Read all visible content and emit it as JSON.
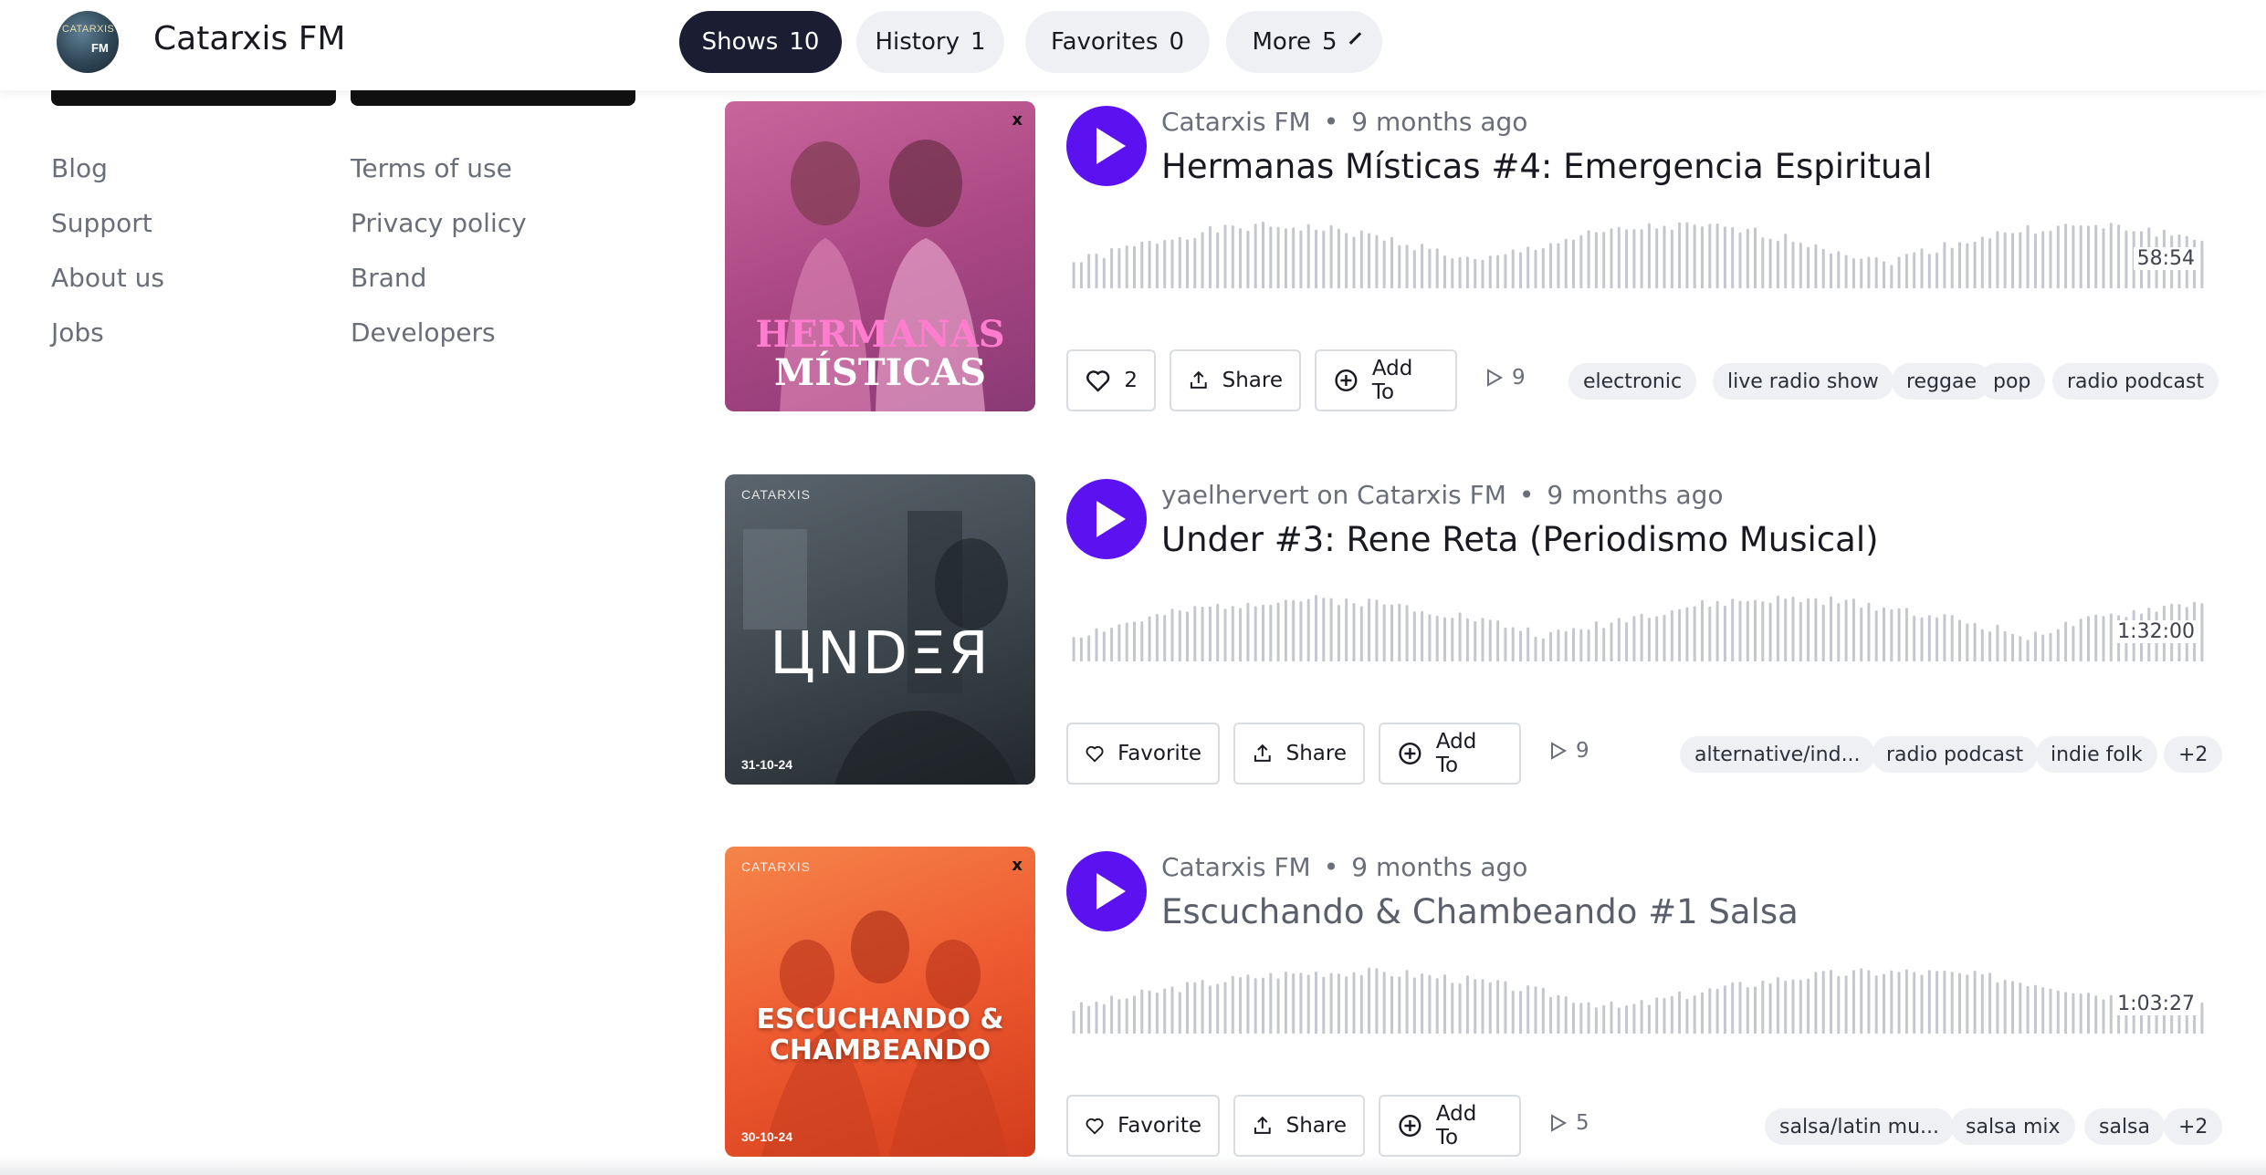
{
  "header": {
    "brand_name": "Catarxis FM",
    "avatar_text_top": "CATARXIS",
    "avatar_text_bottom": "FM",
    "tabs": [
      {
        "label": "Shows",
        "count": "10",
        "active": true
      },
      {
        "label": "History",
        "count": "1",
        "active": false
      },
      {
        "label": "Favorites",
        "count": "0",
        "active": false
      },
      {
        "label": "More",
        "count": "5",
        "active": false
      }
    ]
  },
  "sidebar": {
    "links_col1": [
      "Blog",
      "Support",
      "About us",
      "Jobs"
    ],
    "links_col2": [
      "Terms of use",
      "Privacy policy",
      "Brand",
      "Developers"
    ]
  },
  "shows": [
    {
      "author": "Catarxis FM",
      "time": "9 months ago",
      "title": "Hermanas Místicas #4: Emergencia Espiritual",
      "duration": "58:54",
      "favorite_count": "2",
      "share_label": "Share",
      "add_label": "Add To",
      "plays": "9",
      "tags": [
        "electronic",
        "live radio show",
        "reggae",
        "pop",
        "radio podcast"
      ],
      "art_title_line1": "HERMANAS",
      "art_title_line2": "MÍSTICAS",
      "art_colors": [
        "#b8528c",
        "#8a3a76"
      ]
    },
    {
      "author": "yaelhervert on Catarxis FM",
      "time": "9 months ago",
      "title": "Under #3: Rene Reta (Periodismo Musical)",
      "duration": "1:32:00",
      "favorite_label": "Favorite",
      "share_label": "Share",
      "add_label": "Add To",
      "plays": "9",
      "tags": [
        "alternative/ind...",
        "radio podcast",
        "indie folk",
        "+2"
      ],
      "art_small": "CATARXIS",
      "art_title_line1": "ЦNDΞЯ",
      "art_date": "31-10-24",
      "art_colors": [
        "#4a535b",
        "#262c31"
      ]
    },
    {
      "author": "Catarxis FM",
      "time": "9 months ago",
      "title": "Escuchando & Chambeando #1 Salsa",
      "duration": "1:03:27",
      "favorite_label": "Favorite",
      "share_label": "Share",
      "add_label": "Add To",
      "plays": "5",
      "tags": [
        "salsa/latin mu...",
        "salsa mix",
        "salsa",
        "+2"
      ],
      "art_small": "CATARXIS",
      "art_title_line1": "ESCUCHANDO &",
      "art_title_line2": "CHAMBEANDO",
      "art_date": "30-10-24",
      "art_colors": [
        "#f36a3a",
        "#d8421f"
      ]
    }
  ],
  "colors": {
    "accent": "#5c12f0",
    "active_tab": "#1b1d33",
    "pill_bg": "#eef0f3",
    "muted_text": "#6a6e78"
  },
  "icons": [
    "heart-icon",
    "share-icon",
    "add-circle-icon",
    "play-count-icon",
    "chevron-down-icon",
    "play-icon"
  ]
}
